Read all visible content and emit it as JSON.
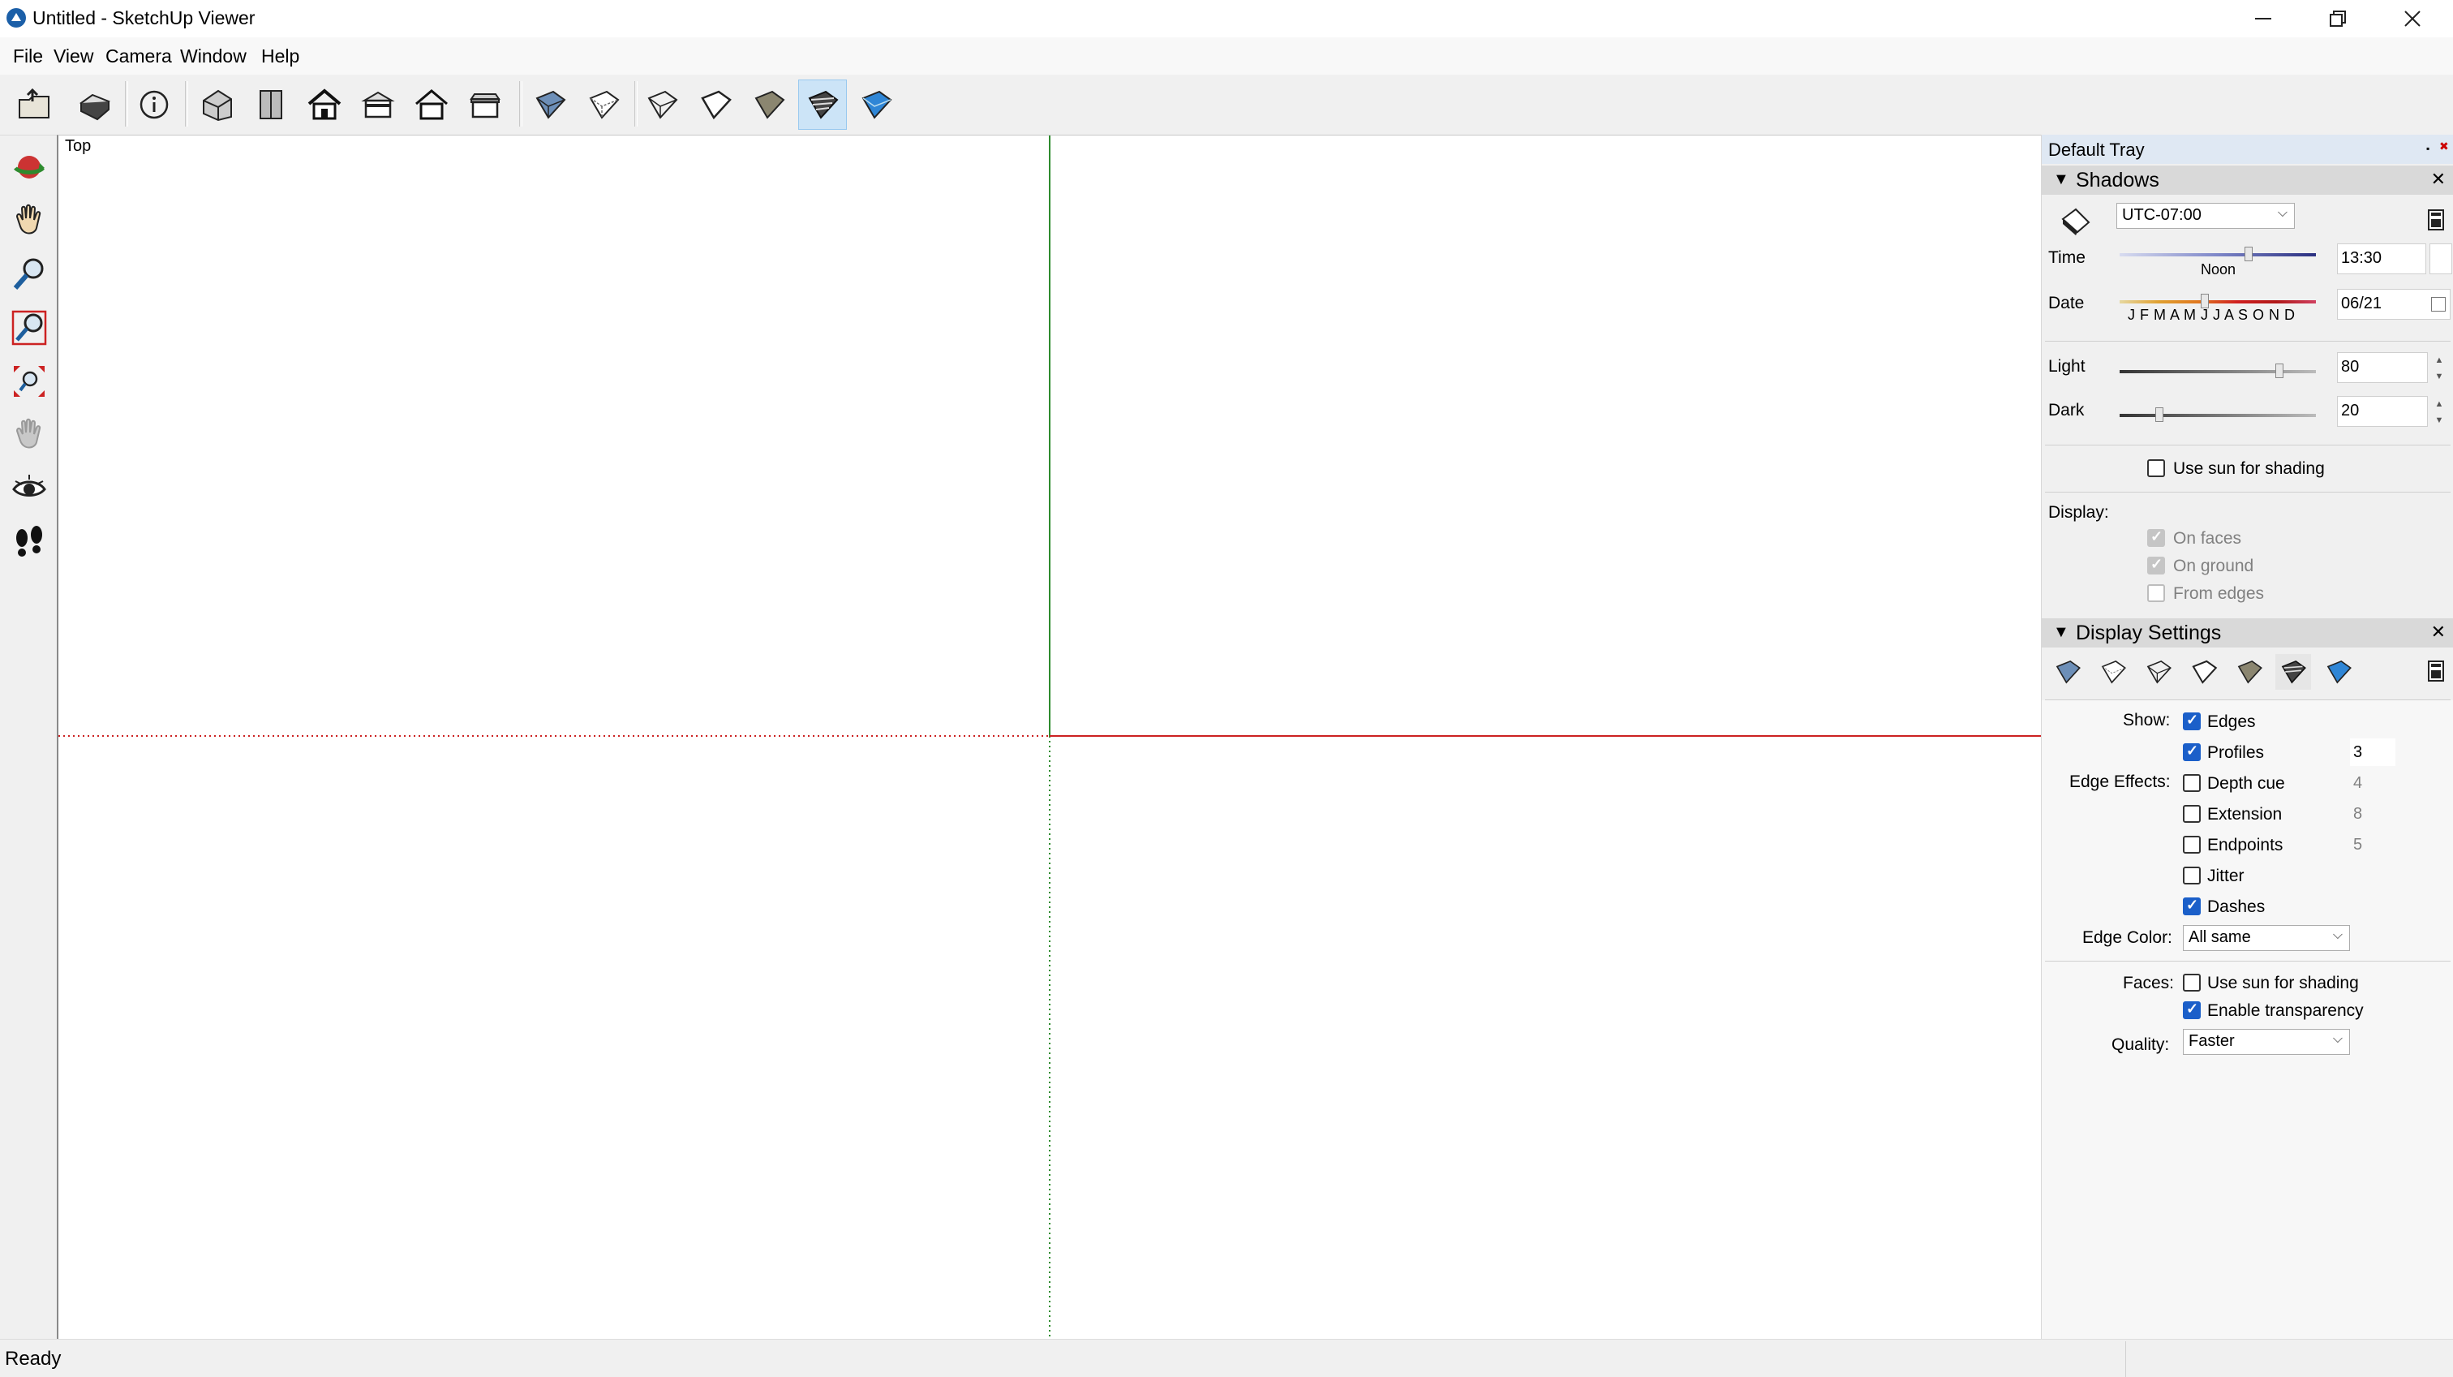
{
  "window": {
    "title": "Untitled - SketchUp Viewer",
    "minimize": "—",
    "maximize": "❐",
    "close": "✕"
  },
  "menu": [
    "File",
    "View",
    "Camera",
    "Window",
    "Help"
  ],
  "viewport": {
    "view_label": "Top",
    "axis_colors": {
      "green": "#2e8b2e",
      "red": "#cc2222"
    }
  },
  "status": {
    "text": "Ready"
  },
  "tray": {
    "title": "Default Tray",
    "shadows": {
      "title": "Shadows",
      "timezone": "UTC-07:00",
      "time_label": "Time",
      "time_mark": "Noon",
      "time_value": "13:30",
      "date_label": "Date",
      "months": "J F M A M J J A S O N D",
      "date_value": "06/21",
      "light_label": "Light",
      "light_value": "80",
      "dark_label": "Dark",
      "dark_value": "20",
      "use_sun_label": "Use sun for shading",
      "display_label": "Display:",
      "on_faces": "On faces",
      "on_ground": "On ground",
      "from_edges": "From edges"
    },
    "display_settings": {
      "title": "Display Settings",
      "show_label": "Show:",
      "edges": "Edges",
      "profiles": "Profiles",
      "profiles_value": "3",
      "edge_effects_label": "Edge Effects:",
      "depth_cue": "Depth cue",
      "depth_cue_value": "4",
      "extension": "Extension",
      "extension_value": "8",
      "endpoints": "Endpoints",
      "endpoints_value": "5",
      "jitter": "Jitter",
      "dashes": "Dashes",
      "edge_color_label": "Edge Color:",
      "edge_color_value": "All same",
      "faces_label": "Faces:",
      "faces_use_sun": "Use sun for shading",
      "enable_transparency": "Enable transparency",
      "quality_label": "Quality:",
      "quality_value": "Faster"
    }
  }
}
